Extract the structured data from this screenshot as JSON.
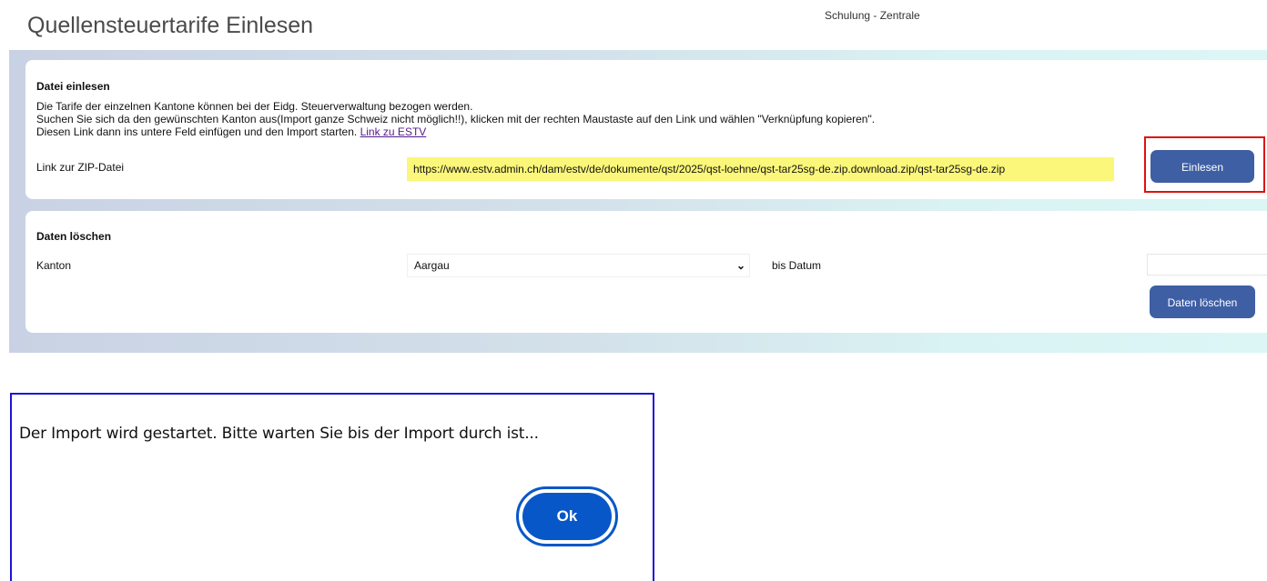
{
  "header": {
    "title": "Quellensteuertarife Einlesen",
    "company": "Schulung - Zentrale"
  },
  "import_section": {
    "title": "Datei einlesen",
    "line1": "Die Tarife der einzelnen Kantone können bei der Eidg. Steuerverwaltung bezogen werden.",
    "line2": "Suchen Sie sich da den gewünschten Kanton aus(Import ganze Schweiz nicht möglich!!), klicken mit der rechten Maustaste auf den Link und wählen \"Verknüpfung kopieren\".",
    "line3": "Diesen Link dann ins untere Feld einfügen und den Import starten.",
    "link_text": "Link zu ESTV",
    "zip_label": "Link zur ZIP-Datei",
    "zip_value": "https://www.estv.admin.ch/dam/estv/de/dokumente/qst/2025/qst-loehne/qst-tar25sg-de.zip.download.zip/qst-tar25sg-de.zip",
    "button_label": "Einlesen"
  },
  "delete_section": {
    "title": "Daten löschen",
    "kanton_label": "Kanton",
    "kanton_selected": "Aargau",
    "date_label": "bis Datum",
    "date_value": "",
    "button_label": "Daten löschen"
  },
  "dialog": {
    "message": "Der Import wird gestartet. Bitte warten Sie bis der Import durch ist...",
    "ok_label": "Ok"
  },
  "colors": {
    "button": "#3f5fa4",
    "highlight": "#fbf77a",
    "red_frame": "#e01010",
    "dialog_border": "#1d13d6",
    "ok_button": "#0857c9"
  },
  "icons": {
    "select_arrow": "chevron-down-icon"
  }
}
